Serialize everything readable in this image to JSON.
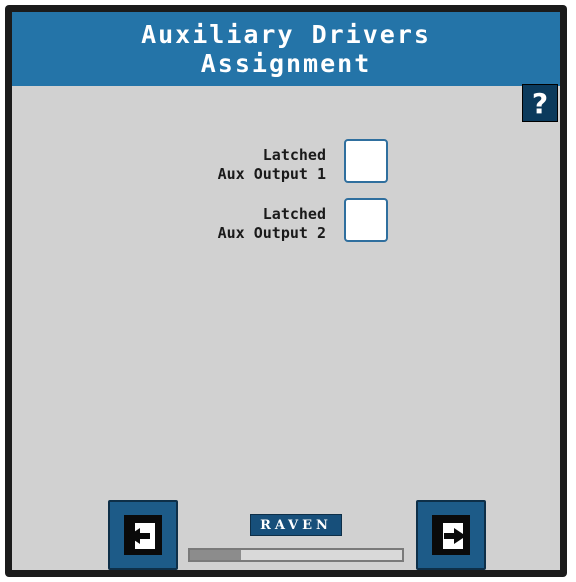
{
  "header": {
    "title_line1": "Auxiliary Drivers",
    "title_line2": "Assignment"
  },
  "help_button": {
    "label": "?"
  },
  "options": [
    {
      "line1": "Latched",
      "line2": "Aux Output 1",
      "checked": false
    },
    {
      "line1": "Latched",
      "line2": "Aux Output 2",
      "checked": false
    }
  ],
  "footer": {
    "prev_icon": "page-back-icon",
    "next_icon": "page-forward-icon",
    "logo": "RAVEN",
    "progress_fraction": 0.24
  },
  "colors": {
    "header_bg": "#2474a8",
    "panel_bg": "#d1d1d1",
    "button_bg": "#1d5b88",
    "help_bg": "#0b3a5c"
  }
}
